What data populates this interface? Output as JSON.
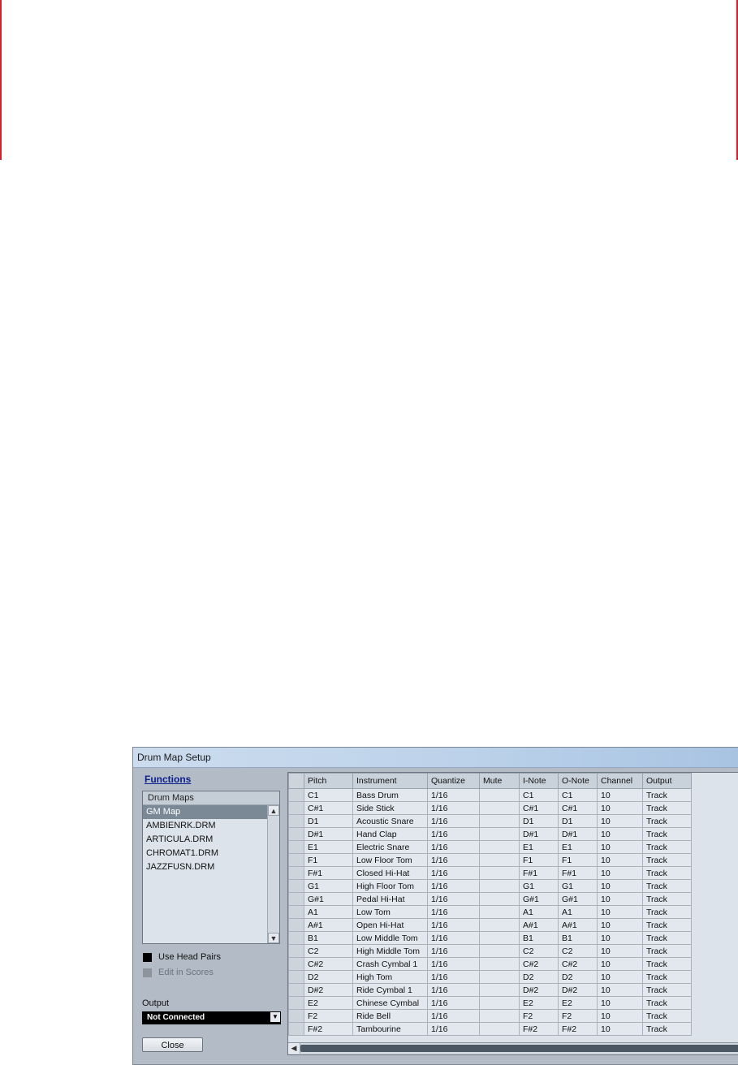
{
  "window": {
    "title": "Drum Map Setup"
  },
  "functions_label": "Functions",
  "drum_maps": {
    "header": "Drum Maps",
    "items": [
      "GM Map",
      "AMBIENRK.DRM",
      "ARTICULA.DRM",
      "CHROMAT1.DRM",
      "JAZZFUSN.DRM"
    ],
    "selected": "GM Map"
  },
  "options": {
    "use_head_pairs": "Use Head Pairs",
    "edit_in_scores": "Edit in Scores"
  },
  "output": {
    "label": "Output",
    "value": "Not Connected"
  },
  "close_label": "Close",
  "table": {
    "columns": [
      "Pitch",
      "Instrument",
      "Quantize",
      "Mute",
      "I-Note",
      "O-Note",
      "Channel",
      "Output"
    ],
    "rows": [
      [
        "C1",
        "Bass Drum",
        "1/16",
        "",
        "C1",
        "C1",
        "10",
        "Track"
      ],
      [
        "C#1",
        "Side Stick",
        "1/16",
        "",
        "C#1",
        "C#1",
        "10",
        "Track"
      ],
      [
        "D1",
        "Acoustic Snare",
        "1/16",
        "",
        "D1",
        "D1",
        "10",
        "Track"
      ],
      [
        "D#1",
        "Hand Clap",
        "1/16",
        "",
        "D#1",
        "D#1",
        "10",
        "Track"
      ],
      [
        "E1",
        "Electric Snare",
        "1/16",
        "",
        "E1",
        "E1",
        "10",
        "Track"
      ],
      [
        "F1",
        "Low Floor Tom",
        "1/16",
        "",
        "F1",
        "F1",
        "10",
        "Track"
      ],
      [
        "F#1",
        "Closed Hi-Hat",
        "1/16",
        "",
        "F#1",
        "F#1",
        "10",
        "Track"
      ],
      [
        "G1",
        "High Floor Tom",
        "1/16",
        "",
        "G1",
        "G1",
        "10",
        "Track"
      ],
      [
        "G#1",
        "Pedal Hi-Hat",
        "1/16",
        "",
        "G#1",
        "G#1",
        "10",
        "Track"
      ],
      [
        "A1",
        "Low Tom",
        "1/16",
        "",
        "A1",
        "A1",
        "10",
        "Track"
      ],
      [
        "A#1",
        "Open Hi-Hat",
        "1/16",
        "",
        "A#1",
        "A#1",
        "10",
        "Track"
      ],
      [
        "B1",
        "Low Middle Tom",
        "1/16",
        "",
        "B1",
        "B1",
        "10",
        "Track"
      ],
      [
        "C2",
        "High Middle Tom",
        "1/16",
        "",
        "C2",
        "C2",
        "10",
        "Track"
      ],
      [
        "C#2",
        "Crash Cymbal 1",
        "1/16",
        "",
        "C#2",
        "C#2",
        "10",
        "Track"
      ],
      [
        "D2",
        "High Tom",
        "1/16",
        "",
        "D2",
        "D2",
        "10",
        "Track"
      ],
      [
        "D#2",
        "Ride Cymbal 1",
        "1/16",
        "",
        "D#2",
        "D#2",
        "10",
        "Track"
      ],
      [
        "E2",
        "Chinese Cymbal",
        "1/16",
        "",
        "E2",
        "E2",
        "10",
        "Track"
      ],
      [
        "F2",
        "Ride Bell",
        "1/16",
        "",
        "F2",
        "F2",
        "10",
        "Track"
      ],
      [
        "F#2",
        "Tambourine",
        "1/16",
        "",
        "F#2",
        "F#2",
        "10",
        "Track"
      ]
    ]
  }
}
